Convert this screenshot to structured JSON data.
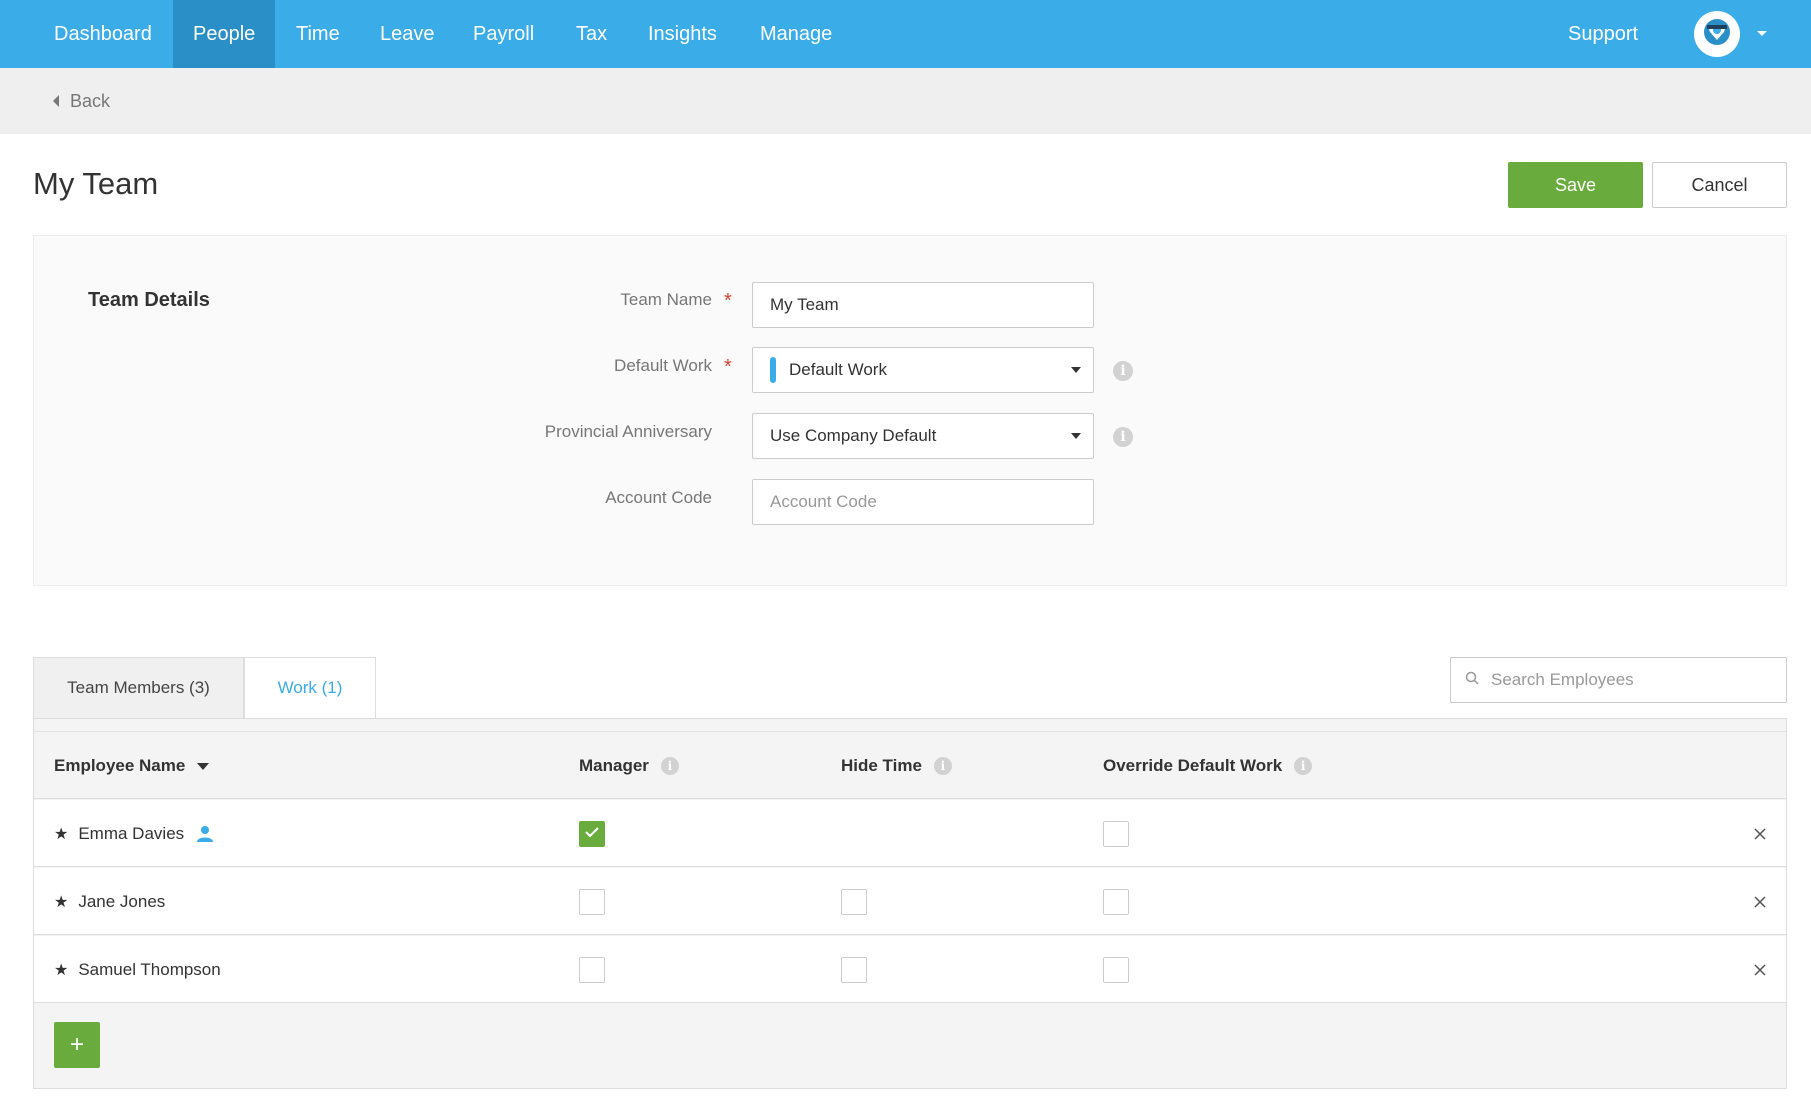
{
  "nav": {
    "items": [
      {
        "label": "Dashboard",
        "active": false
      },
      {
        "label": "People",
        "active": true
      },
      {
        "label": "Time",
        "active": false
      },
      {
        "label": "Leave",
        "active": false
      },
      {
        "label": "Payroll",
        "active": false
      },
      {
        "label": "Tax",
        "active": false
      },
      {
        "label": "Insights",
        "active": false
      },
      {
        "label": "Manage",
        "active": false
      }
    ],
    "support_label": "Support",
    "avatar_icon": "user-avatar-icon",
    "brand_color": "#3aace8",
    "active_color": "#2a8fc6"
  },
  "back": {
    "label": "Back",
    "icon": "caret-left-icon"
  },
  "page": {
    "title": "My Team"
  },
  "actions": {
    "save_label": "Save",
    "cancel_label": "Cancel",
    "save_color": "#6aab3e"
  },
  "details": {
    "section_title": "Team Details",
    "team_name": {
      "label": "Team Name",
      "value": "My Team",
      "required": true
    },
    "default_work": {
      "label": "Default Work",
      "value": "Default Work",
      "required": true,
      "color": "#3aace8"
    },
    "provincial_anniversary": {
      "label": "Provincial Anniversary",
      "value": "Use Company Default"
    },
    "account_code": {
      "label": "Account Code",
      "placeholder": "Account Code",
      "value": ""
    }
  },
  "tabs": [
    {
      "label": "Team Members (3)",
      "active": true
    },
    {
      "label": "Work (1)",
      "active": false
    }
  ],
  "search": {
    "placeholder": "Search Employees",
    "icon": "search-icon"
  },
  "table": {
    "columns": [
      {
        "label": "Employee Name",
        "sortable": true
      },
      {
        "label": "Manager",
        "info": true
      },
      {
        "label": "Hide Time",
        "info": true
      },
      {
        "label": "Override Default Work",
        "info": true
      }
    ],
    "rows": [
      {
        "name": "Emma Davies",
        "is_current_user": true,
        "manager": true,
        "hide_time": null,
        "override_default_work": false
      },
      {
        "name": "Jane Jones",
        "is_current_user": false,
        "manager": false,
        "hide_time": false,
        "override_default_work": false
      },
      {
        "name": "Samuel Thompson",
        "is_current_user": false,
        "manager": false,
        "hide_time": false,
        "override_default_work": false
      }
    ],
    "add_label": "+"
  }
}
